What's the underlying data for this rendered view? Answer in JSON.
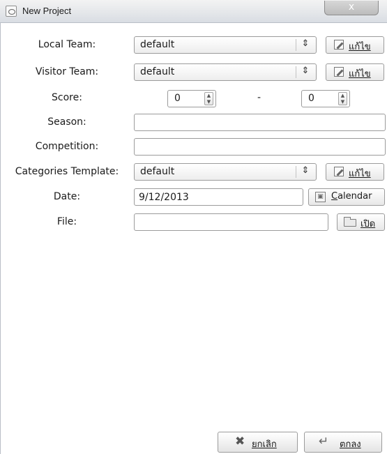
{
  "window": {
    "title": "New Project",
    "close_label": "x"
  },
  "form": {
    "local_team": {
      "label": "Local Team:",
      "value": "default",
      "edit_label": "แก้ไข"
    },
    "visitor_team": {
      "label": "Visitor Team:",
      "value": "default",
      "edit_label": "แก้ไข"
    },
    "score": {
      "label": "Score:",
      "local": "0",
      "visitor": "0",
      "separator": "-"
    },
    "season": {
      "label": "Season:",
      "value": ""
    },
    "competition": {
      "label": "Competition:",
      "value": ""
    },
    "categories_template": {
      "label": "Categories Template:",
      "value": "default",
      "edit_label": "แก้ไข"
    },
    "date": {
      "label": "Date:",
      "value": "9/12/2013",
      "calendar_mnemonic": "C",
      "calendar_rest": "alendar"
    },
    "file": {
      "label": "File:",
      "value": "",
      "open_label": "เปิด"
    }
  },
  "buttons": {
    "cancel_label": "ยกเลิก",
    "ok_label": "ตกลง"
  },
  "icons": {
    "app": "app-icon",
    "edit": "edit-icon",
    "calendar": "calendar-icon",
    "folder": "folder-open-icon",
    "cancel": "cancel-x-icon",
    "ok": "ok-return-icon"
  }
}
